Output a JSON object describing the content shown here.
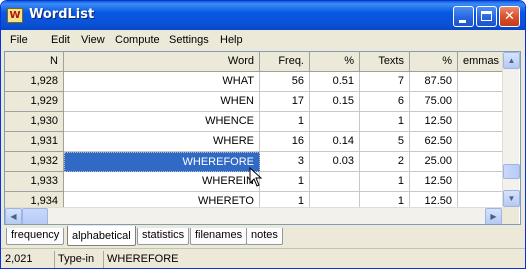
{
  "window": {
    "title": "WordList",
    "icon_label": "W"
  },
  "titlebar_buttons": {
    "close_glyph": "✕"
  },
  "menu": [
    "File",
    "Edit",
    "View",
    "Compute",
    "Settings",
    "Help"
  ],
  "table": {
    "headers": [
      "N",
      "Word",
      "Freq.",
      "%",
      "Texts",
      "%",
      "emmas"
    ],
    "rows": [
      [
        "1,928",
        "WHAT",
        "56",
        "0.51",
        "7",
        "87.50",
        ""
      ],
      [
        "1,929",
        "WHEN",
        "17",
        "0.15",
        "6",
        "75.00",
        ""
      ],
      [
        "1,930",
        "WHENCE",
        "1",
        "",
        "1",
        "12.50",
        ""
      ],
      [
        "1,931",
        "WHERE",
        "16",
        "0.14",
        "5",
        "62.50",
        ""
      ],
      [
        "1,932",
        "WHEREFORE",
        "3",
        "0.03",
        "2",
        "25.00",
        ""
      ],
      [
        "1,933",
        "WHEREIN",
        "1",
        "",
        "1",
        "12.50",
        ""
      ],
      [
        "1,934",
        "WHERETO",
        "1",
        "",
        "1",
        "12.50",
        ""
      ]
    ],
    "selected_row_index": 4
  },
  "scrollbars": {
    "up_arrow": "▲",
    "down_arrow": "▼",
    "left_arrow": "◀",
    "right_arrow": "▶"
  },
  "tabs": [
    {
      "label": "frequency",
      "active": false
    },
    {
      "label": "alphabetical",
      "active": true
    },
    {
      "label": "statistics",
      "active": false
    },
    {
      "label": "filenames",
      "active": false
    },
    {
      "label": "notes",
      "active": false
    }
  ],
  "status": {
    "count": "2,021",
    "mode": "Type-in",
    "current_word": "WHEREFORE"
  },
  "colors": {
    "selection": "#316ac5",
    "titlebar": "#0758e6",
    "face": "#ece9d8"
  }
}
